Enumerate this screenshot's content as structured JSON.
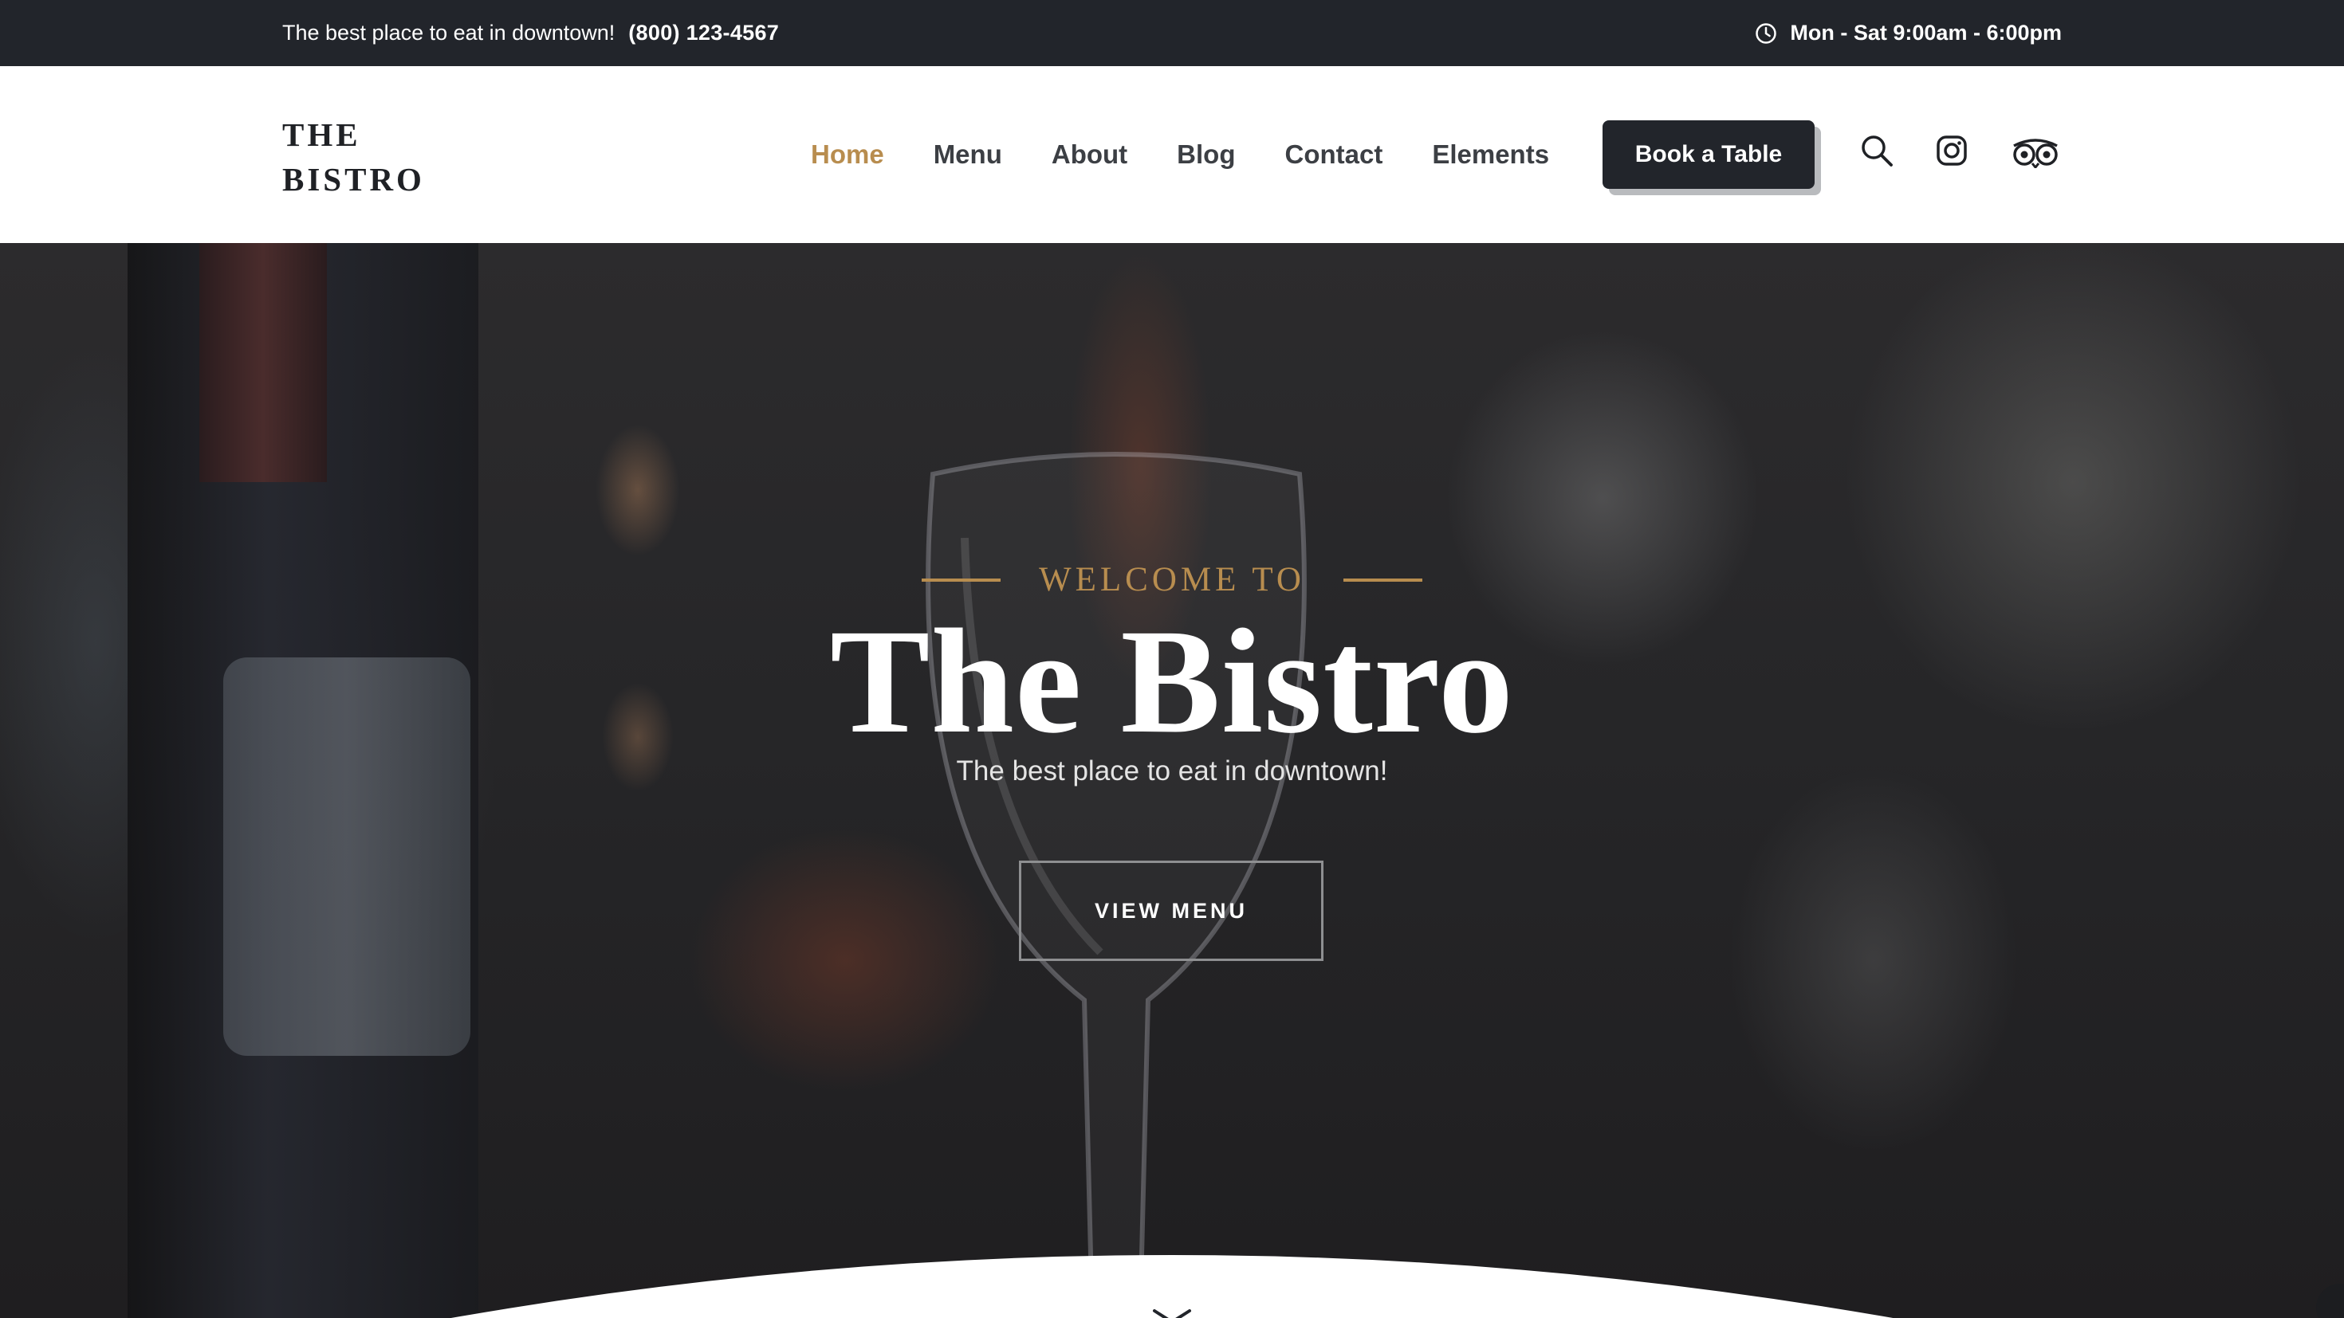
{
  "topbar": {
    "tagline": "The best place to eat in downtown!",
    "phone": "(800) 123-4567",
    "hours": "Mon - Sat 9:00am - 6:00pm",
    "icon": "clock-icon"
  },
  "header": {
    "logo_line1": "THE",
    "logo_line2": "BISTRO",
    "nav": [
      "Home",
      "Menu",
      "About",
      "Blog",
      "Contact",
      "Elements"
    ],
    "active_nav": "Home",
    "book_label": "Book a Table",
    "icons": [
      "search-icon",
      "instagram-icon",
      "tripadvisor-icon"
    ]
  },
  "hero": {
    "kicker": "WELCOME TO",
    "title": "The Bistro",
    "subtitle": "The best place to eat in downtown!",
    "cta": "VIEW MENU",
    "scroll_icon": "chevron-down-icon"
  },
  "colors": {
    "accent": "#b88d4f",
    "dark": "#22252b",
    "white": "#ffffff"
  }
}
